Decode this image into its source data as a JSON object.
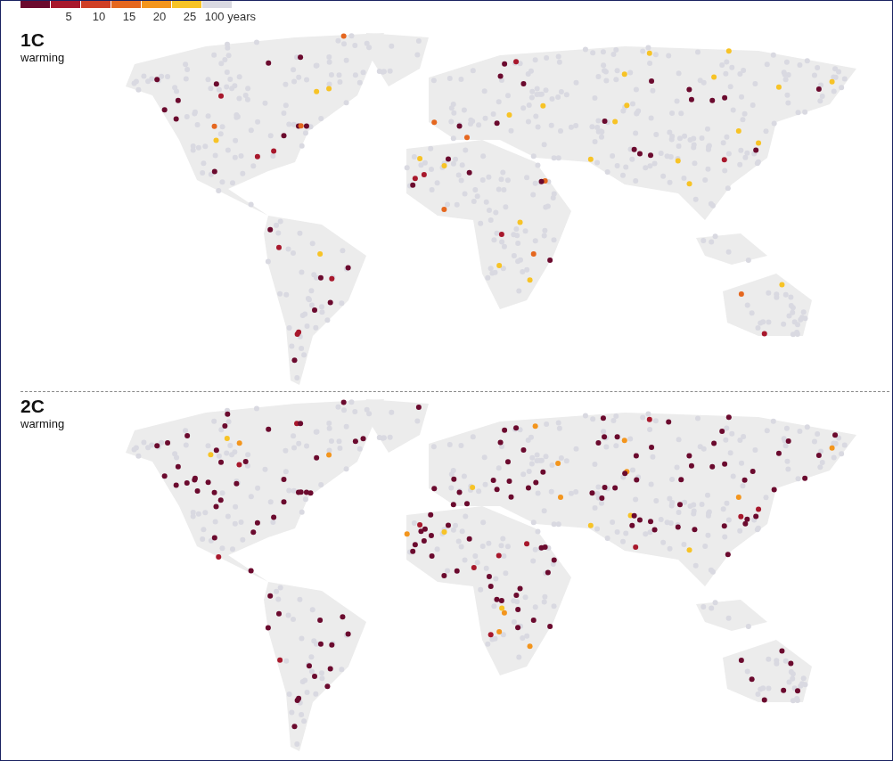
{
  "legend": {
    "segments": [
      {
        "color": "#6b0a2e"
      },
      {
        "color": "#a8182c"
      },
      {
        "color": "#cf3f26"
      },
      {
        "color": "#e5671f"
      },
      {
        "color": "#f3951d"
      },
      {
        "color": "#f7c326"
      },
      {
        "color": "#d9d9e1"
      }
    ],
    "labels": [
      "5",
      "10",
      "15",
      "20",
      "25",
      "100 years"
    ]
  },
  "panels": [
    {
      "title": "1C",
      "subtitle": "warming"
    },
    {
      "title": "2C",
      "subtitle": "warming"
    }
  ]
}
